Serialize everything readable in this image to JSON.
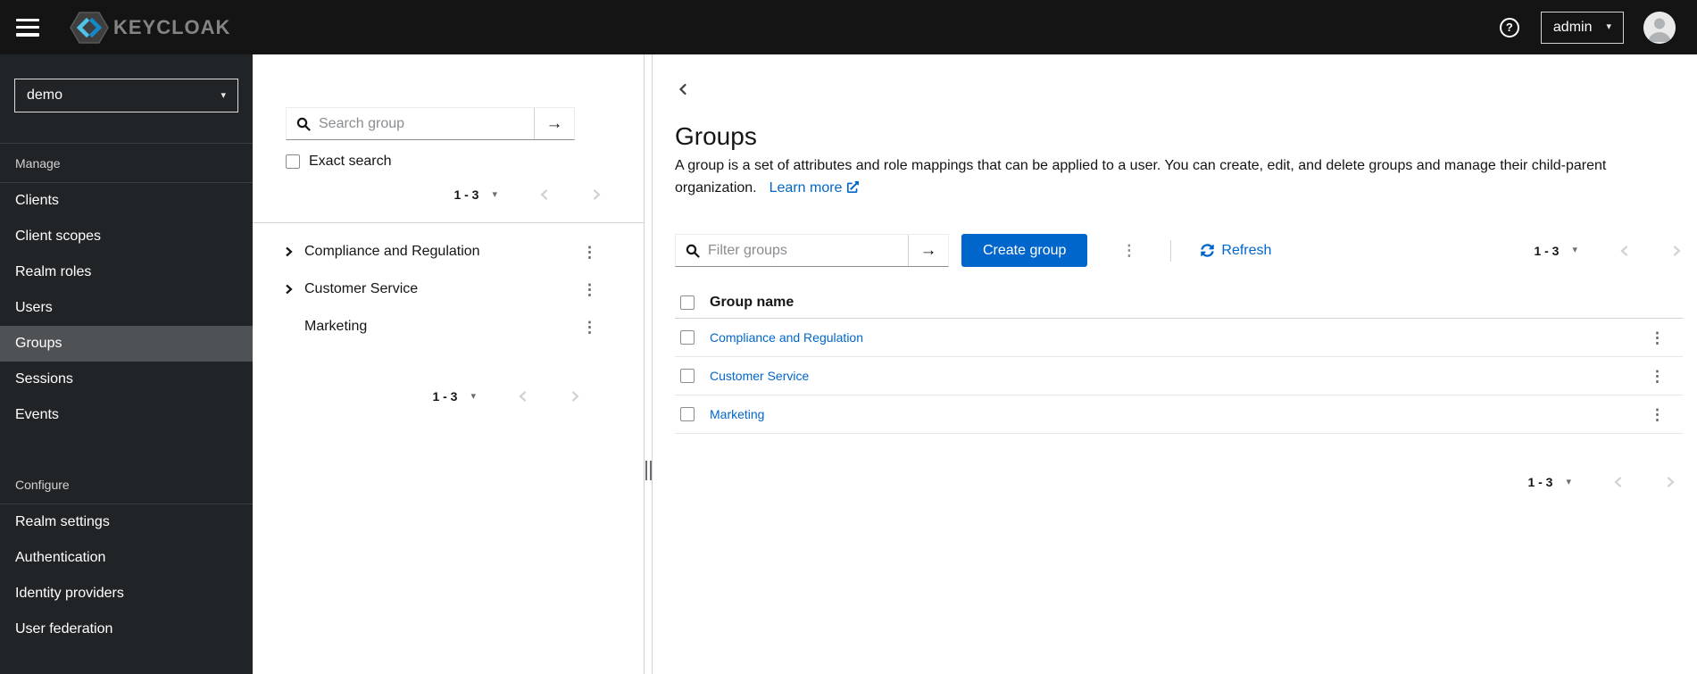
{
  "masthead": {
    "brand": "KEYCLOAK",
    "help_glyph": "?",
    "user_menu_label": "admin"
  },
  "sidebar": {
    "realm_selector_value": "demo",
    "selected_item": "Groups",
    "sections": [
      {
        "title": "Manage",
        "items": [
          {
            "label": "Clients"
          },
          {
            "label": "Client scopes"
          },
          {
            "label": "Realm roles"
          },
          {
            "label": "Users"
          },
          {
            "label": "Groups"
          },
          {
            "label": "Sessions"
          },
          {
            "label": "Events"
          }
        ]
      },
      {
        "title": "Configure",
        "items": [
          {
            "label": "Realm settings"
          },
          {
            "label": "Authentication"
          },
          {
            "label": "Identity providers"
          },
          {
            "label": "User federation"
          }
        ]
      }
    ]
  },
  "tree_panel": {
    "search_placeholder": "Search group",
    "exact_search_label": "Exact search",
    "pagination_top": "1 - 3",
    "pagination_bottom": "1 - 3",
    "items": [
      {
        "label": "Compliance and Regulation",
        "expandable": true
      },
      {
        "label": "Customer Service",
        "expandable": true
      },
      {
        "label": "Marketing",
        "expandable": false
      }
    ]
  },
  "main": {
    "title": "Groups",
    "description": "A group is a set of attributes and role mappings that can be applied to a user. You can create, edit, and delete groups and manage their child-parent organization.",
    "learn_more": "Learn more",
    "toolbar": {
      "filter_placeholder": "Filter groups",
      "create_label": "Create group",
      "refresh_label": "Refresh",
      "pagination": "1 - 3"
    },
    "table": {
      "header": "Group name",
      "rows": [
        {
          "name": "Compliance and Regulation"
        },
        {
          "name": "Customer Service"
        },
        {
          "name": "Marketing"
        }
      ]
    },
    "pagination_bottom": "1 - 3"
  },
  "icons": {
    "caret_glyph": "▾",
    "arrow_glyph": "→",
    "kebab_glyph": "⋮"
  },
  "colors": {
    "primary": "#0066cc",
    "link": "#0066cc",
    "masthead_bg": "#141414",
    "sidebar_bg": "#212427",
    "selected_nav_bg": "#4f5255"
  }
}
